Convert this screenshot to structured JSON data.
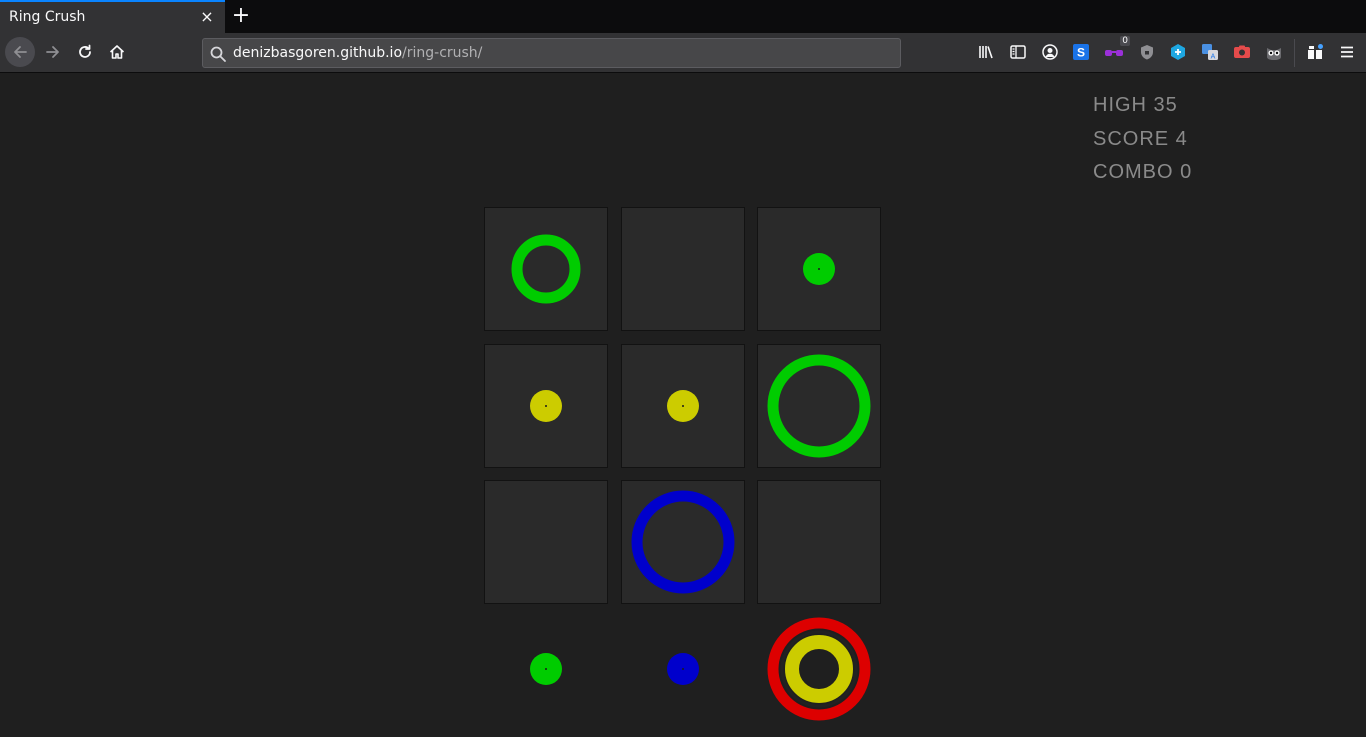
{
  "browser": {
    "tab_title": "Ring Crush",
    "tab_close": "×",
    "new_tab": "+",
    "url_domain": "denizbasgoren.github.io",
    "url_path": "/ring-crush/",
    "extension_badge": "0",
    "icons": [
      "back-icon",
      "forward-icon",
      "reload-icon",
      "home-icon",
      "search-icon",
      "library-icon",
      "sidebar-icon",
      "account-icon",
      "extension-s-icon",
      "extension-glasses-icon",
      "extension-shield-icon",
      "extension-cube-icon",
      "extension-translate-icon",
      "extension-camera-icon",
      "extension-owl-icon",
      "extensions-icon",
      "menu-icon"
    ]
  },
  "hud": {
    "high": "HIGH 35",
    "score": "SCORE 4",
    "combo": "COMBO 0"
  },
  "colors": {
    "green": "#00cc00",
    "yellow": "#cccc00",
    "blue": "#0000cc",
    "red": "#dd0000",
    "cell_bg": "#2a2a2a",
    "page_bg": "#1f1f1f"
  },
  "board": [
    [
      {
        "small": "green",
        "medium": null,
        "large": null
      },
      {
        "small": null,
        "medium": null,
        "large": null
      },
      {
        "small": null,
        "medium": "green",
        "large": null
      }
    ],
    [
      {
        "small": null,
        "medium": "yellow",
        "large": null
      },
      {
        "small": null,
        "medium": "yellow",
        "large": null
      },
      {
        "small": null,
        "medium": null,
        "large": "green"
      }
    ],
    [
      {
        "small": null,
        "medium": null,
        "large": null
      },
      {
        "small": null,
        "medium": null,
        "large": "blue"
      },
      {
        "small": null,
        "medium": null,
        "large": null
      }
    ]
  ],
  "hand": [
    {
      "dot": "green"
    },
    {
      "dot": "blue"
    },
    {
      "medium": "yellow",
      "large": "red"
    }
  ]
}
